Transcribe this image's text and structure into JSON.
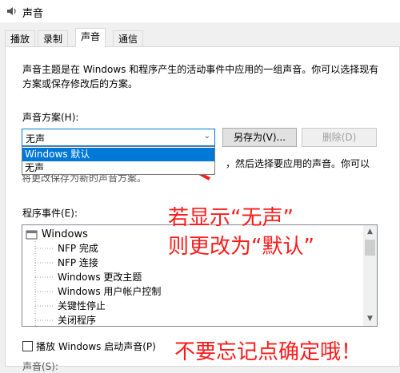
{
  "window": {
    "title": "声音"
  },
  "tabs": [
    {
      "label": "播放"
    },
    {
      "label": "录制"
    },
    {
      "label": "声音"
    },
    {
      "label": "通信"
    }
  ],
  "description": "声音主题是在 Windows 和程序产生的活动事件中应用的一组声音。你可以选择现有方案或保存修改后的方案。",
  "scheme": {
    "label": "声音方案(H):",
    "selected": "无声",
    "options": [
      "Windows 默认",
      "无声"
    ]
  },
  "buttons": {
    "save_as": "另存为(V)...",
    "delete": "删除(D)"
  },
  "partial_text": {
    "line1": "，然后选择要应用的声音。你可以",
    "line2": "将更改保存为新的声音方案。"
  },
  "events": {
    "label": "程序事件(E):",
    "root": "Windows",
    "items": [
      "NFP 完成",
      "NFP 连接",
      "Windows 更改主题",
      "Windows 用户帐户控制",
      "关键性停止",
      "关闭程序"
    ]
  },
  "startup": {
    "label": "播放 Windows 启动声音(P)"
  },
  "bottom_cut": "声音(S):",
  "annotations": {
    "line1": "若显示“无声”",
    "line2": "则更改为“默认”",
    "line3": "不要忘记点确定哦！"
  },
  "colors": {
    "accent": "#0078d7",
    "annotation": "#ff1a1a"
  }
}
